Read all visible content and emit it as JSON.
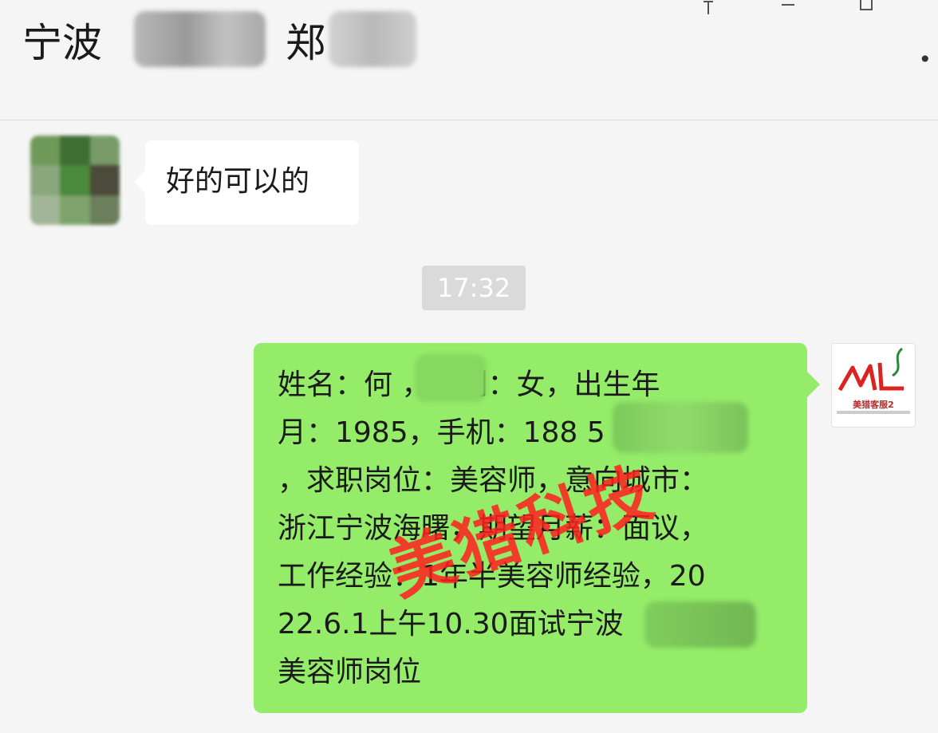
{
  "header": {
    "title_part1": "宁波",
    "title_part2": "郑",
    "window_controls": [
      "pin-icon",
      "minimize-icon",
      "maximize-icon"
    ],
    "more_icon": "more-dots-icon"
  },
  "messages": {
    "incoming": {
      "text": "好的可以的"
    },
    "timestamp": "17:32",
    "outgoing": {
      "lines": [
        "姓名：何    ，性别：女，出生年",
        "月：1985，手机：188        5",
        "，求职岗位：美容师，意向城市：",
        "浙江宁波海曙，期望月薪：面议，",
        "工作经验：1年半美容师经验，20",
        "22.6.1上午10.30面试宁波",
        "美容师岗位"
      ],
      "watermark": "美猎科技",
      "avatar_logo_text": "美猎客服2"
    }
  },
  "colors": {
    "background": "#f5f5f5",
    "incoming_bubble": "#ffffff",
    "outgoing_bubble": "#95ec69",
    "watermark": "#ff1f1f",
    "timestamp_bg": "#dadada"
  }
}
